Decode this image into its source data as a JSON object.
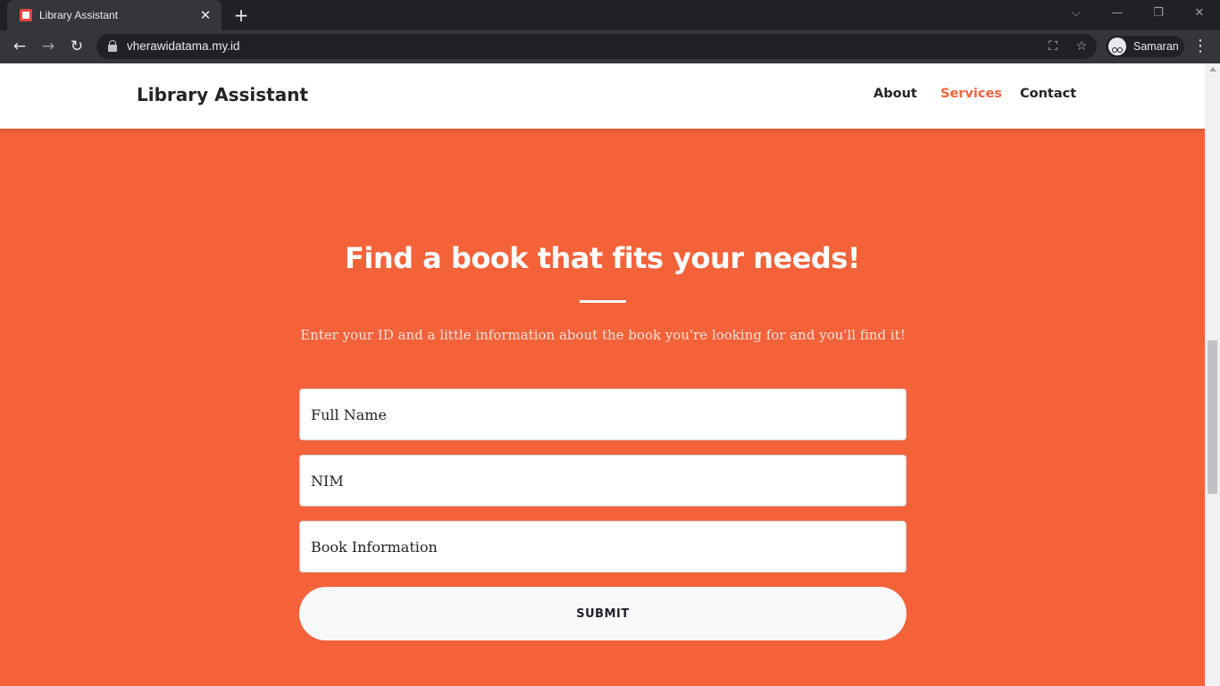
{
  "browser": {
    "tab_title": "Library Assistant",
    "tab_close": "✕",
    "new_tab": "+",
    "url": "vherawidatama.my.id",
    "profile_name": "Samaran",
    "window_controls": {
      "dropdown": "⌵",
      "minimize": "—",
      "restore": "❐",
      "close": "✕"
    },
    "nav": {
      "back": "←",
      "forward": "→",
      "reload": "↻"
    },
    "omnibox_icons": {
      "translate": "⛶",
      "bookmark": "☆"
    },
    "menu": "⋮"
  },
  "navbar": {
    "brand": "Library Assistant",
    "links": [
      {
        "label": "About",
        "active": false
      },
      {
        "label": "Services",
        "active": true
      },
      {
        "label": "Contact",
        "active": false
      }
    ]
  },
  "hero": {
    "title": "Find a book that fits your needs!",
    "subtitle": "Enter your ID and a little information about the book you're looking for and you'll find it!"
  },
  "form": {
    "fields": [
      {
        "placeholder": "Full Name",
        "value": ""
      },
      {
        "placeholder": "NIM",
        "value": ""
      },
      {
        "placeholder": "Book Information",
        "value": ""
      }
    ],
    "submit_label": "SUBMIT"
  },
  "colors": {
    "accent": "#f4623a",
    "text": "#212529",
    "button_bg": "#f8f9fa"
  }
}
